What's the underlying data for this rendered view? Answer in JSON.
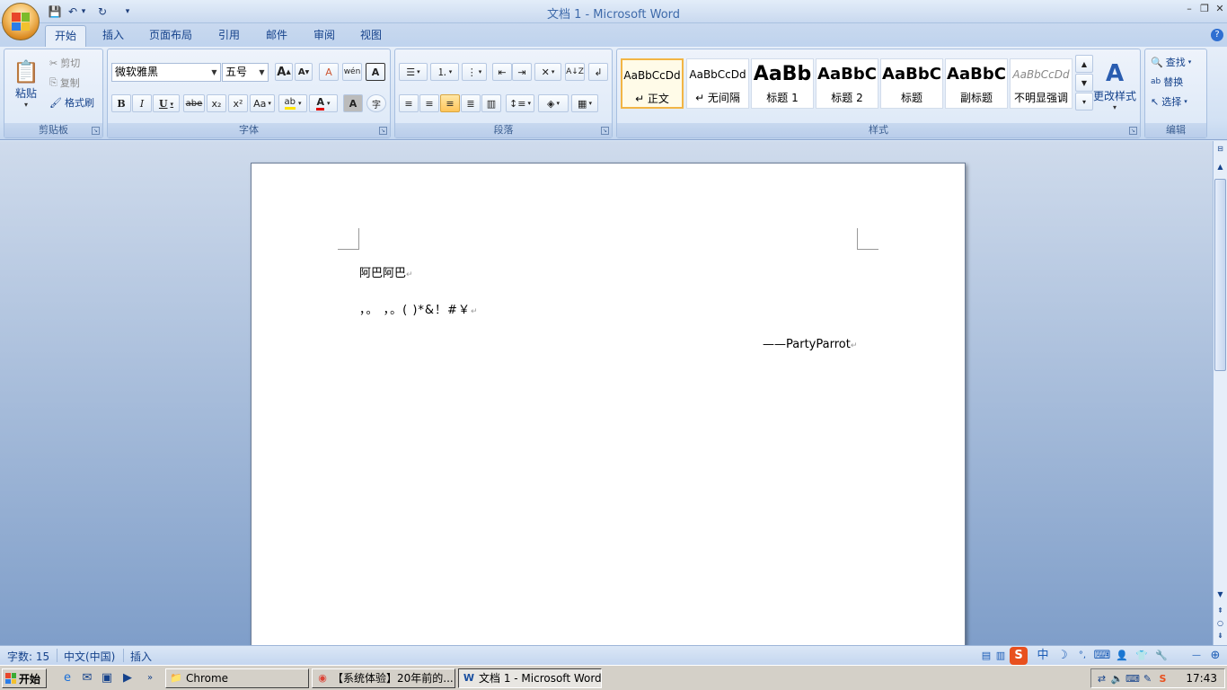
{
  "window": {
    "title": "文档 1 - Microsoft Word",
    "controls": {
      "minimize": "–",
      "restore": "❐",
      "close": "✕"
    }
  },
  "quick_access": [
    {
      "icon": "save-icon",
      "glyph": "💾"
    },
    {
      "icon": "undo-icon",
      "glyph": "↶"
    },
    {
      "icon": "undo-dropdown-icon",
      "glyph": "▾"
    },
    {
      "icon": "redo-icon",
      "glyph": "↻"
    },
    {
      "icon": "customize-qat-icon",
      "glyph": "▾"
    }
  ],
  "tabs": [
    "开始",
    "插入",
    "页面布局",
    "引用",
    "邮件",
    "审阅",
    "视图"
  ],
  "active_tab": "开始",
  "ribbon": {
    "clipboard": {
      "label": "剪贴板",
      "paste": "粘贴",
      "cut": "剪切",
      "copy": "复制",
      "format_painter": "格式刷"
    },
    "font": {
      "label": "字体",
      "font_name": "微软雅黑",
      "font_size": "五号",
      "grow": "A",
      "shrink": "A",
      "clear_format": "A",
      "phonetic": "wén",
      "border_char": "A",
      "bold": "B",
      "italic": "I",
      "underline": "U",
      "strike": "abe",
      "subscript": "x₂",
      "superscript": "x²",
      "change_case": "Aa",
      "highlight": "ab",
      "font_color": "A",
      "shading": "A",
      "enclose": "字"
    },
    "paragraph": {
      "label": "段落"
    },
    "styles": {
      "label": "样式",
      "items": [
        {
          "sample": "AaBbCcDd",
          "name": "↵ 正文"
        },
        {
          "sample": "AaBbCcDd",
          "name": "↵ 无间隔"
        },
        {
          "sample": "AaBb",
          "name": "标题 1"
        },
        {
          "sample": "AaBbC",
          "name": "标题 2"
        },
        {
          "sample": "AaBbC",
          "name": "标题"
        },
        {
          "sample": "AaBbC",
          "name": "副标题"
        },
        {
          "sample": "AaBbCcDd",
          "name": "不明显强调"
        }
      ],
      "change_styles": "更改样式"
    },
    "editing": {
      "label": "编辑",
      "find": "查找",
      "replace": "替换",
      "select": "选择"
    }
  },
  "document": {
    "lines": [
      "阿巴阿巴",
      "，。 ，。( )*&！#￥",
      "——PartyParrot"
    ],
    "para_mark": "↵"
  },
  "statusbar": {
    "word_count": "字数: 15",
    "language": "中文(中国)",
    "mode": "插入"
  },
  "ime": [
    "S",
    "中",
    "☽",
    "°,",
    "⌨",
    "👤",
    "👕",
    "🔧"
  ],
  "taskbar": {
    "start": "开始",
    "tasks": [
      {
        "label": "Chrome",
        "icon": "folder-icon",
        "glyph": "📁"
      },
      {
        "label": "【系统体验】20年前的...",
        "icon": "chrome-icon",
        "glyph": "◉"
      },
      {
        "label": "文档 1 - Microsoft Word",
        "icon": "word-icon",
        "glyph": "W"
      }
    ],
    "clock": "17:43"
  }
}
